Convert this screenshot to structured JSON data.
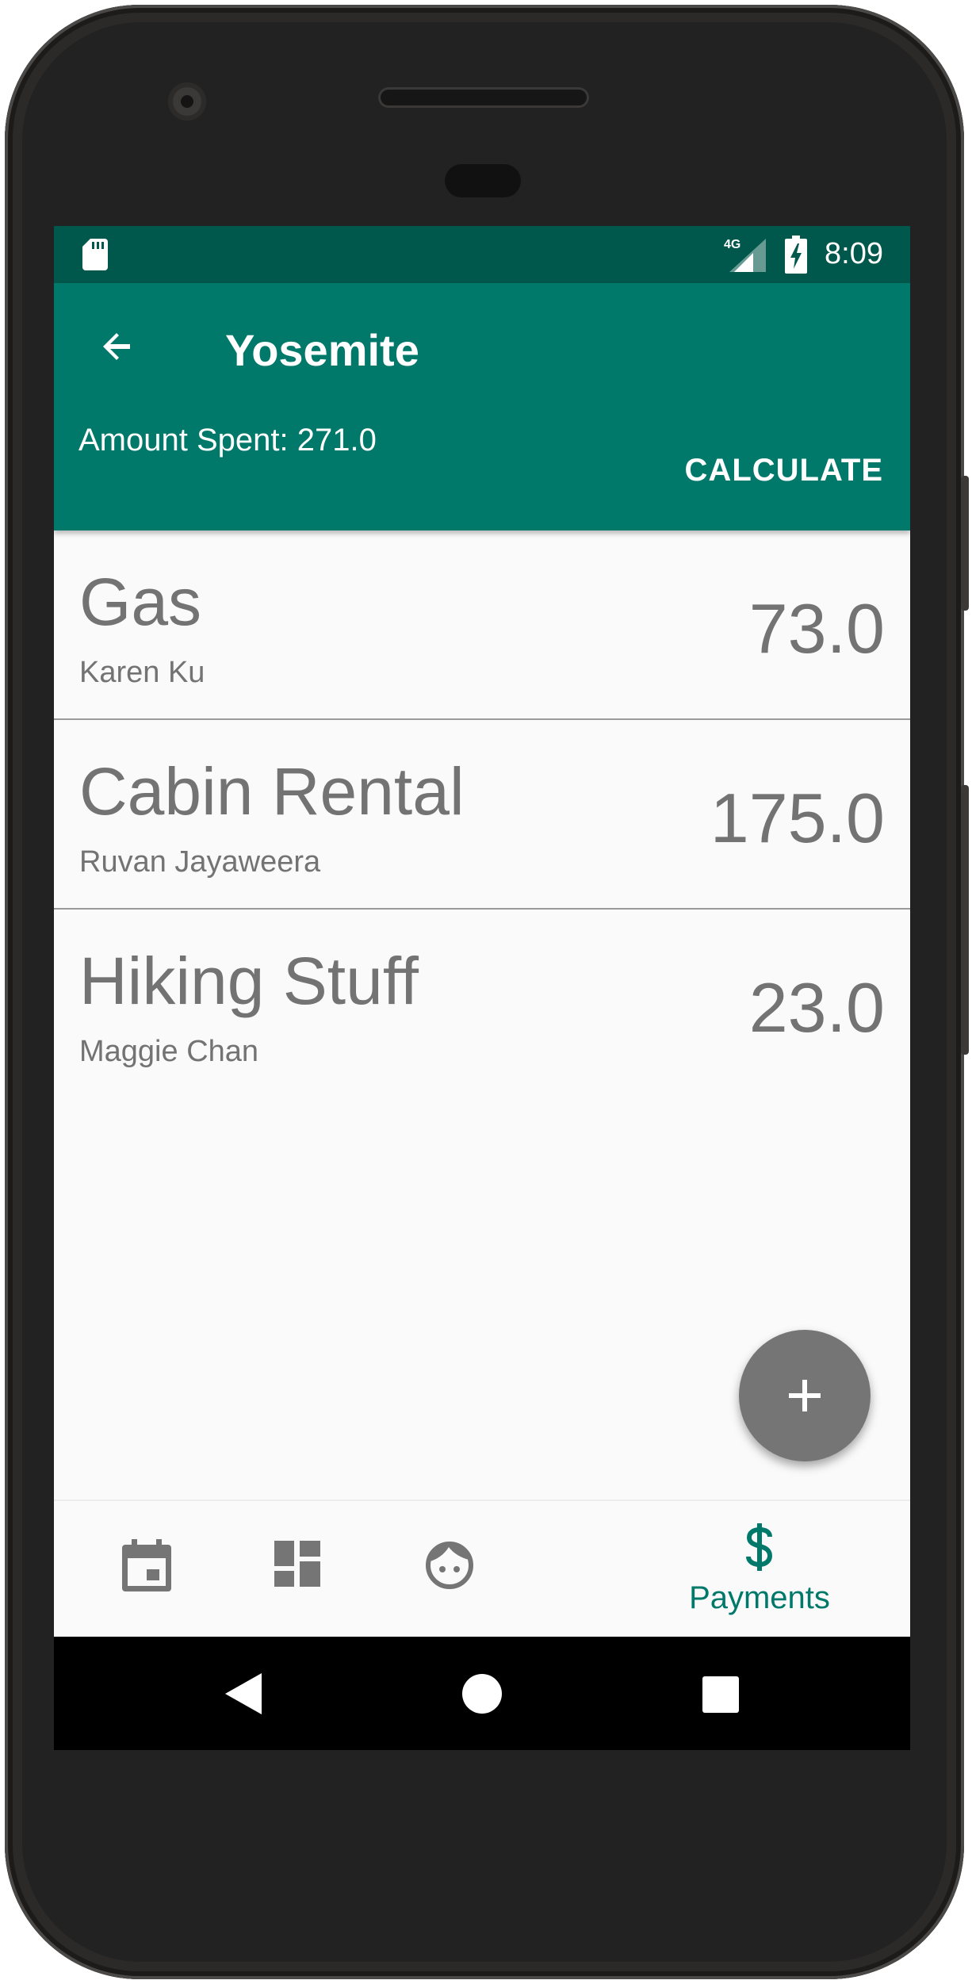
{
  "status_bar": {
    "network": "4G",
    "time": "8:09",
    "icons": [
      "sd-card-icon",
      "signal-icon",
      "battery-charging-icon"
    ]
  },
  "app_bar": {
    "title": "Yosemite",
    "amount_spent": "Amount Spent: 271.0",
    "calculate_label": "CALCULATE",
    "back_icon": "arrow-back-icon"
  },
  "payments": [
    {
      "name": "Gas",
      "payer": "Karen Ku",
      "amount": "73.0"
    },
    {
      "name": "Cabin Rental",
      "payer": "Ruvan Jayaweera",
      "amount": "175.0"
    },
    {
      "name": "Hiking Stuff",
      "payer": "Maggie Chan",
      "amount": "23.0"
    }
  ],
  "fab": {
    "icon": "plus-icon"
  },
  "bottom_nav": {
    "items": [
      {
        "icon": "calendar-icon",
        "label": ""
      },
      {
        "icon": "dashboard-icon",
        "label": ""
      },
      {
        "icon": "face-icon",
        "label": ""
      },
      {
        "icon": "dollar-icon",
        "label": "Payments",
        "active": true
      }
    ]
  },
  "colors": {
    "primary": "#00796b",
    "primary_dark": "#00574b",
    "text_secondary": "#737373",
    "fab": "#757575",
    "background": "#fafafa"
  }
}
